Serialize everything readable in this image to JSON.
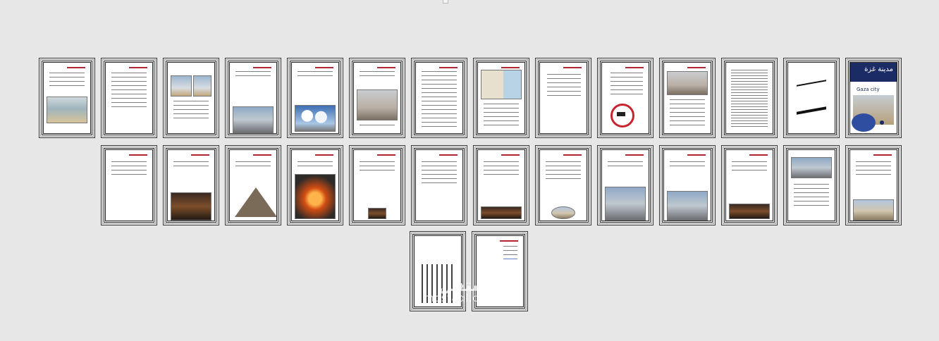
{
  "cover": {
    "title": "مدينة غزة",
    "subtitle": "Gaza city"
  },
  "watermark": {
    "arabic": "مستقل",
    "latin": "mostaql.com"
  },
  "icons": {
    "top_marker": "selection-marker-icon"
  }
}
